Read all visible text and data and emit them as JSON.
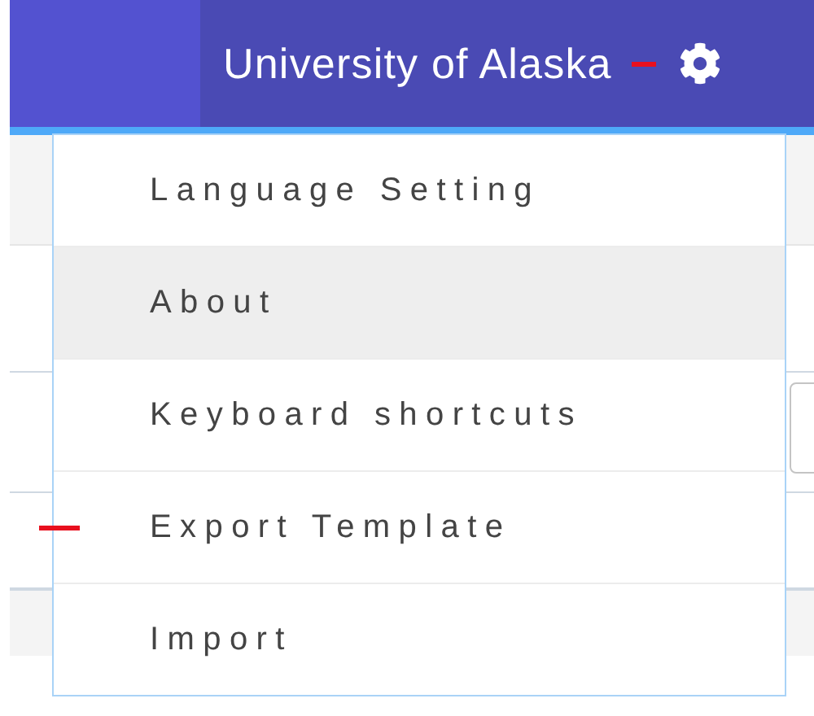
{
  "header": {
    "title": "University of Alaska",
    "marked": true
  },
  "menu": {
    "items": [
      {
        "label": "Language Setting",
        "selected": false,
        "marked": false
      },
      {
        "label": "About",
        "selected": true,
        "marked": false
      },
      {
        "label": "Keyboard shortcuts",
        "selected": false,
        "marked": false
      },
      {
        "label": "Export Template",
        "selected": false,
        "marked": true
      },
      {
        "label": "Import",
        "selected": false,
        "marked": false
      }
    ]
  }
}
